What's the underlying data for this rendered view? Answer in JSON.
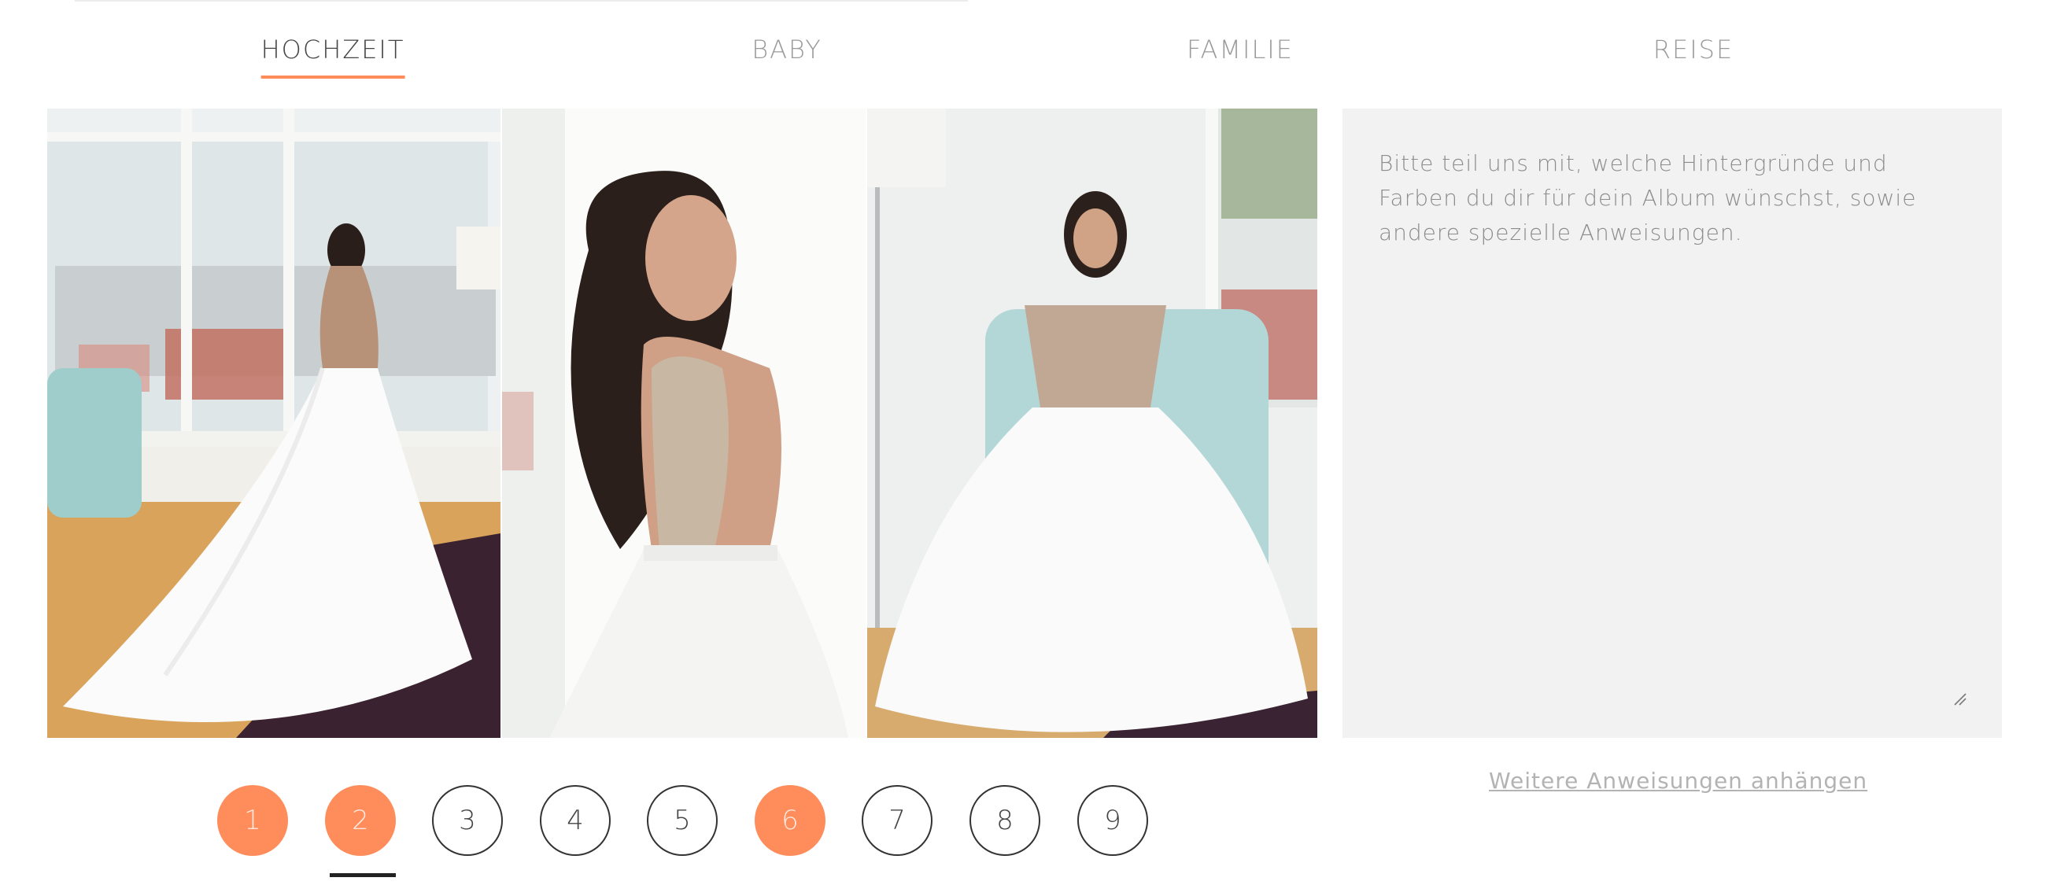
{
  "tabs": [
    {
      "label": "HOCHZEIT",
      "active": true
    },
    {
      "label": "BABY",
      "active": false
    },
    {
      "label": "FAMILIE",
      "active": false
    },
    {
      "label": "REISE",
      "active": false
    }
  ],
  "photos": [
    {
      "name": "photo-bride-window-back"
    },
    {
      "name": "photo-bride-over-shoulder"
    },
    {
      "name": "photo-bride-seated-chair"
    }
  ],
  "notes": {
    "placeholder": "Bitte teil uns mit, welche Hintergründe und Farben du dir für dein Album wünschst, sowie andere spezielle Anweisungen."
  },
  "attach_link": "Weitere Anweisungen anhängen",
  "pager": {
    "pages": [
      "1",
      "2",
      "3",
      "4",
      "5",
      "6",
      "7",
      "8",
      "9"
    ],
    "selected": [
      "1",
      "2",
      "6"
    ],
    "current": "2"
  },
  "colors": {
    "accent": "#ff8d5c",
    "panel": "#f2f2f2",
    "text": "#444444",
    "muted": "#9a9a9a"
  },
  "icons": {
    "resize": "resize-handle-icon"
  }
}
